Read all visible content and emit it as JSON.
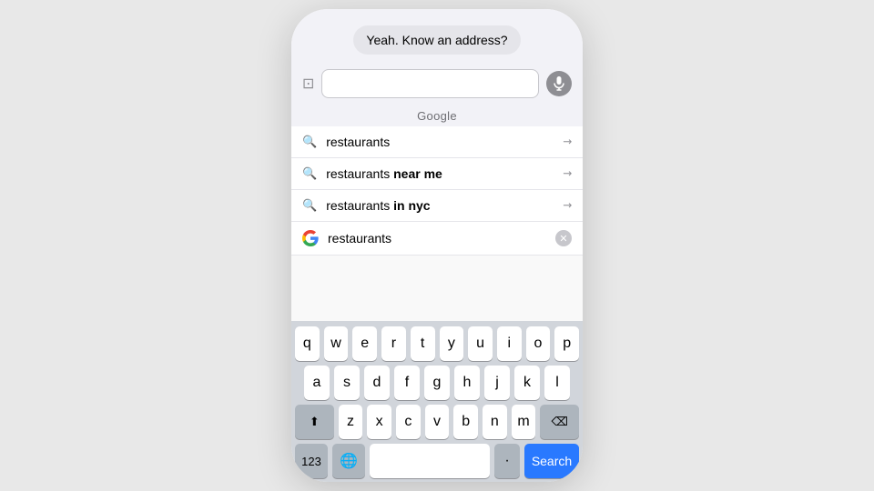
{
  "message": {
    "text": "Yeah. Know an address?"
  },
  "safariBar": {
    "placeholder": "",
    "cameraIcon": "📷",
    "micIcon": "🎤"
  },
  "googleLabel": "Google",
  "suggestions": [
    {
      "text": "restaurants",
      "boldPart": "",
      "arrowLabel": "↙"
    },
    {
      "text": "restaurants near me",
      "boldPart": "near me",
      "arrowLabel": "↙"
    },
    {
      "text": "restaurants in nyc",
      "boldPart": "in nyc",
      "arrowLabel": "↙"
    }
  ],
  "activeSearch": {
    "text": "restaurants"
  },
  "keyboard": {
    "rows": [
      [
        "q",
        "w",
        "e",
        "r",
        "t",
        "y",
        "u",
        "i",
        "o",
        "p"
      ],
      [
        "a",
        "s",
        "d",
        "f",
        "g",
        "h",
        "j",
        "k",
        "l"
      ],
      [
        "z",
        "x",
        "c",
        "v",
        "b",
        "n",
        "m"
      ]
    ],
    "numbersLabel": "123",
    "spaceLabel": "",
    "dotLabel": "·",
    "searchLabel": "Search"
  }
}
